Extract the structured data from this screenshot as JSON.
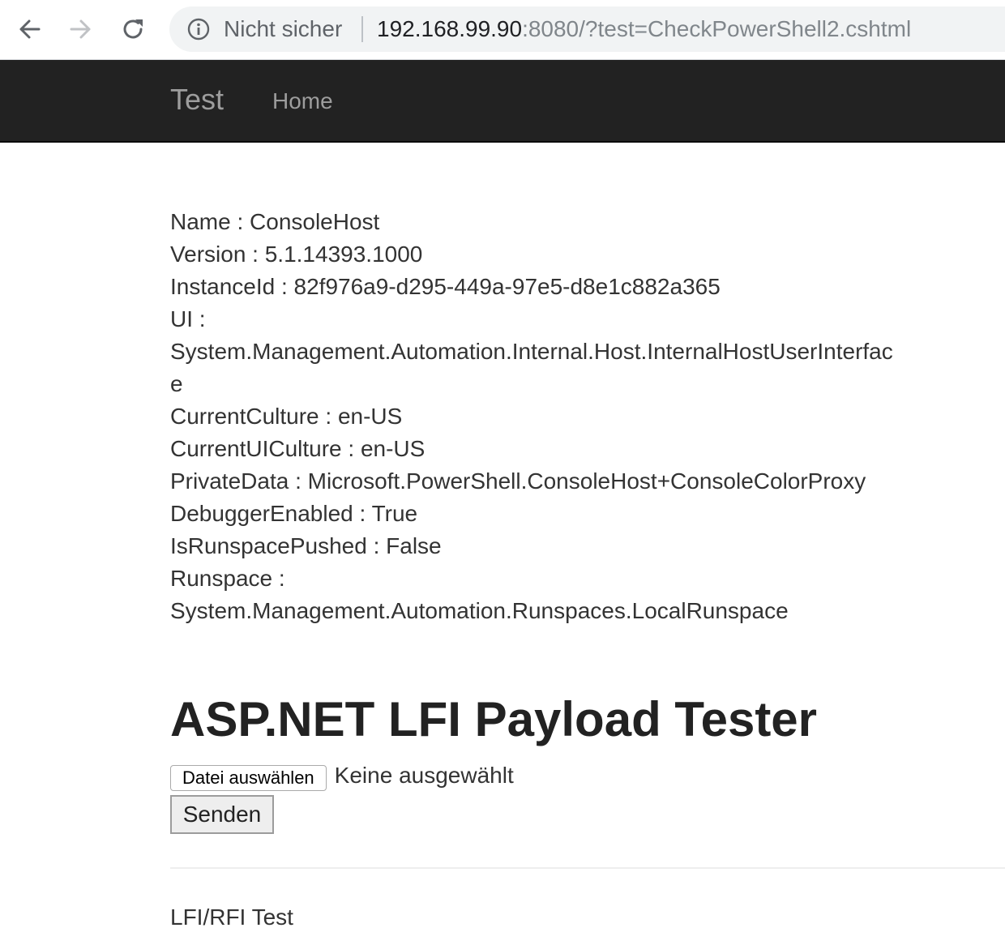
{
  "browser": {
    "back_icon": "arrow-left-icon",
    "forward_icon": "arrow-right-icon",
    "reload_icon": "reload-icon",
    "security_icon": "info-icon",
    "security_label": "Nicht sicher",
    "url_host": "192.168.99.90",
    "url_rest": ":8080/?test=CheckPowerShell2.cshtml"
  },
  "navbar": {
    "brand": "Test",
    "links": [
      {
        "label": "Home"
      }
    ],
    "background": "#222222"
  },
  "host_info": [
    "Name : ConsoleHost",
    "Version : 5.1.14393.1000",
    "InstanceId : 82f976a9-d295-449a-97e5-d8e1c882a365",
    "UI : System.Management.Automation.Internal.Host.InternalHostUserInterface",
    "CurrentCulture : en-US",
    "CurrentUICulture : en-US",
    "PrivateData : Microsoft.PowerShell.ConsoleHost+ConsoleColorProxy",
    "DebuggerEnabled : True",
    "IsRunspacePushed : False",
    "Runspace : System.Management.Automation.Runspaces.LocalRunspace"
  ],
  "main": {
    "heading": "ASP.NET LFI Payload Tester",
    "file_button_label": "Datei auswählen",
    "file_status": "Keine ausgewählt",
    "submit_label": "Senden",
    "footer_text": "LFI/RFI Test"
  }
}
